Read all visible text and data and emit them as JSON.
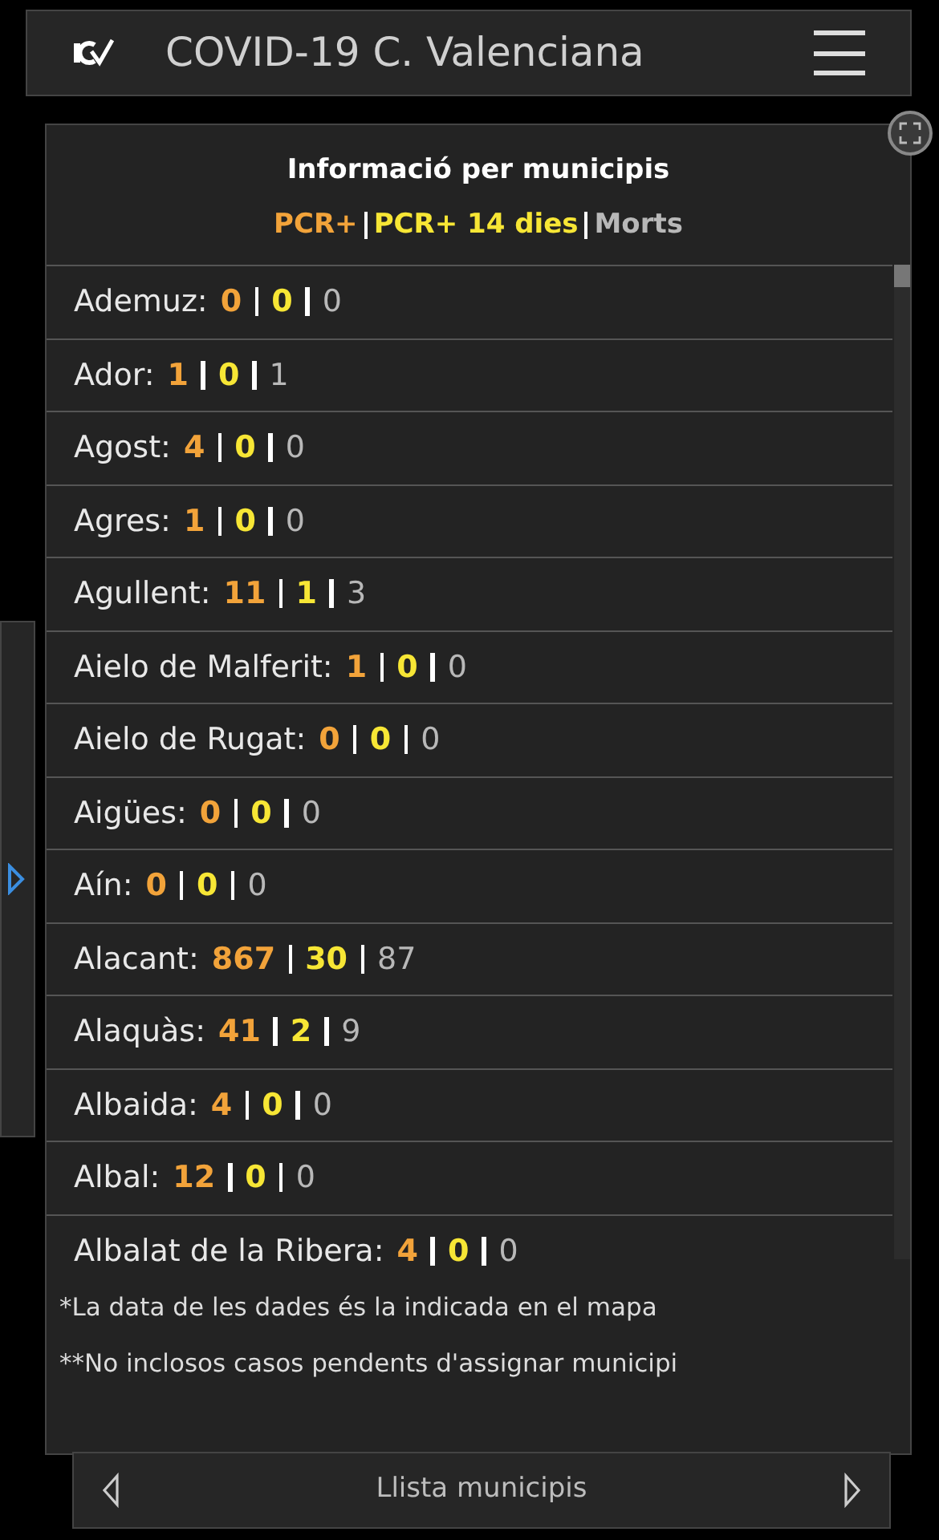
{
  "header": {
    "title": "COVID-19 C. Valenciana"
  },
  "panel": {
    "title": "Informació per municipis",
    "legend": [
      {
        "label": "PCR+",
        "kind": "pcr"
      },
      {
        "label": "PCR+ 14 dies",
        "kind": "pcr14"
      },
      {
        "label": "Morts",
        "kind": "deaths"
      }
    ],
    "rows": [
      {
        "name": "Ademuz:",
        "pcr": "0",
        "pcr14": "0",
        "deaths": "0"
      },
      {
        "name": "Ador:",
        "pcr": "1",
        "pcr14": "0",
        "deaths": "1"
      },
      {
        "name": "Agost:",
        "pcr": "4",
        "pcr14": "0",
        "deaths": "0"
      },
      {
        "name": "Agres:",
        "pcr": "1",
        "pcr14": "0",
        "deaths": "0"
      },
      {
        "name": "Agullent:",
        "pcr": "11",
        "pcr14": "1",
        "deaths": "3"
      },
      {
        "name": "Aielo de Malferit:",
        "pcr": "1",
        "pcr14": "0",
        "deaths": "0"
      },
      {
        "name": "Aielo de Rugat:",
        "pcr": "0",
        "pcr14": "0",
        "deaths": "0"
      },
      {
        "name": "Aigües:",
        "pcr": "0",
        "pcr14": "0",
        "deaths": "0"
      },
      {
        "name": "Aín:",
        "pcr": "0",
        "pcr14": "0",
        "deaths": "0"
      },
      {
        "name": "Alacant:",
        "pcr": "867",
        "pcr14": "30",
        "deaths": "87"
      },
      {
        "name": "Alaquàs:",
        "pcr": "41",
        "pcr14": "2",
        "deaths": "9"
      },
      {
        "name": "Albaida:",
        "pcr": "4",
        "pcr14": "0",
        "deaths": "0"
      },
      {
        "name": "Albal:",
        "pcr": "12",
        "pcr14": "0",
        "deaths": "0"
      },
      {
        "name": "Albalat de la Ribera:",
        "pcr": "4",
        "pcr14": "0",
        "deaths": "0"
      }
    ],
    "notes": [
      "*La data de les dades és la indicada en el mapa",
      "**No inclosos casos pendents d'assignar municipi"
    ]
  },
  "footer": {
    "label": "Llista municipis"
  }
}
